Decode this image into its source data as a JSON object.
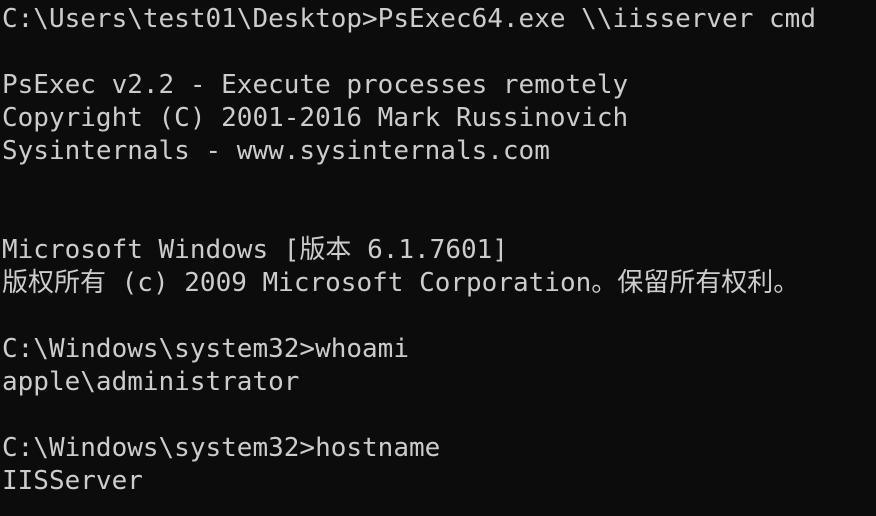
{
  "colors": {
    "background": "#0c0c0c",
    "foreground": "#cccccc"
  },
  "console": {
    "lines": [
      "C:\\Users\\test01\\Desktop>PsExec64.exe \\\\iisserver cmd",
      "",
      "PsExec v2.2 - Execute processes remotely",
      "Copyright (C) 2001-2016 Mark Russinovich",
      "Sysinternals - www.sysinternals.com",
      "",
      "",
      "Microsoft Windows [版本 6.1.7601]",
      "版权所有 (c) 2009 Microsoft Corporation。保留所有权利。",
      "",
      "C:\\Windows\\system32>whoami",
      "apple\\administrator",
      "",
      "C:\\Windows\\system32>hostname",
      "IISServer"
    ]
  }
}
